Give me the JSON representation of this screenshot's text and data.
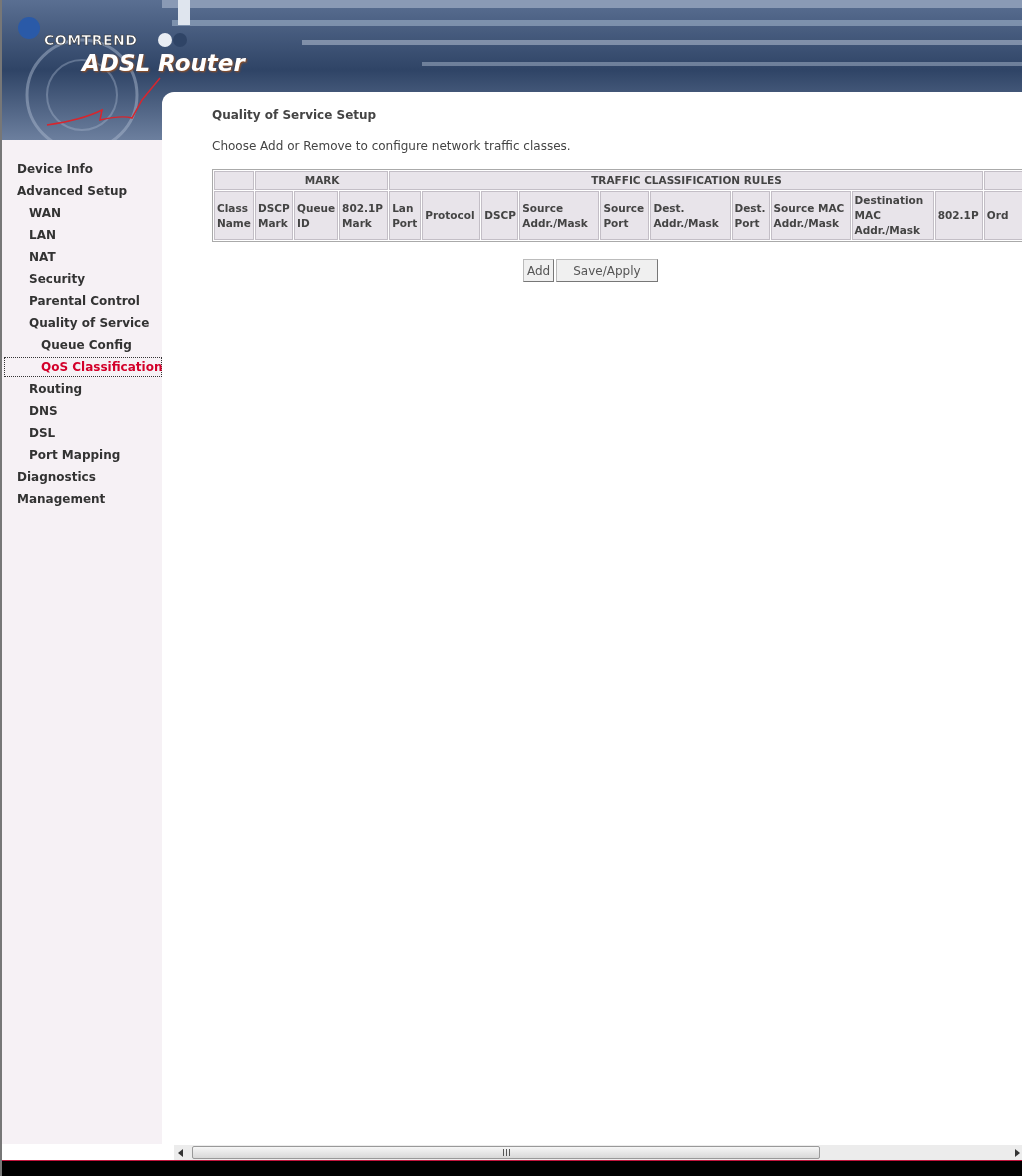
{
  "brand": {
    "company": "COMTREND",
    "product": "ADSL Router"
  },
  "sidebar": {
    "items": [
      {
        "label": "Device Info",
        "selected": false
      },
      {
        "label": "Advanced Setup",
        "selected": false,
        "children": [
          {
            "label": "WAN",
            "selected": false
          },
          {
            "label": "LAN",
            "selected": false
          },
          {
            "label": "NAT",
            "selected": false
          },
          {
            "label": "Security",
            "selected": false
          },
          {
            "label": "Parental Control",
            "selected": false
          },
          {
            "label": "Quality of Service",
            "selected": false,
            "children": [
              {
                "label": "Queue Config",
                "selected": false
              },
              {
                "label": "QoS Classification",
                "selected": true
              }
            ]
          },
          {
            "label": "Routing",
            "selected": false
          },
          {
            "label": "DNS",
            "selected": false
          },
          {
            "label": "DSL",
            "selected": false
          },
          {
            "label": "Port Mapping",
            "selected": false
          }
        ]
      },
      {
        "label": "Diagnostics",
        "selected": false
      },
      {
        "label": "Management",
        "selected": false
      }
    ]
  },
  "page": {
    "title": "Quality of Service Setup",
    "description": "Choose Add or Remove to configure network traffic classes."
  },
  "table": {
    "groups": [
      {
        "label": "MARK"
      },
      {
        "label": "TRAFFIC CLASSIFICATION RULES"
      }
    ],
    "columns": [
      "Class Name",
      "DSCP Mark",
      "Queue ID",
      "802.1P Mark",
      "Lan Port",
      "Protocol",
      "DSCP",
      "Source Addr./Mask",
      "Source Port",
      "Dest. Addr./Mask",
      "Dest. Port",
      "Source MAC Addr./Mask",
      "Destination MAC Addr./Mask",
      "802.1P",
      "Ord"
    ]
  },
  "buttons": [
    "Add",
    "Save/Apply"
  ]
}
